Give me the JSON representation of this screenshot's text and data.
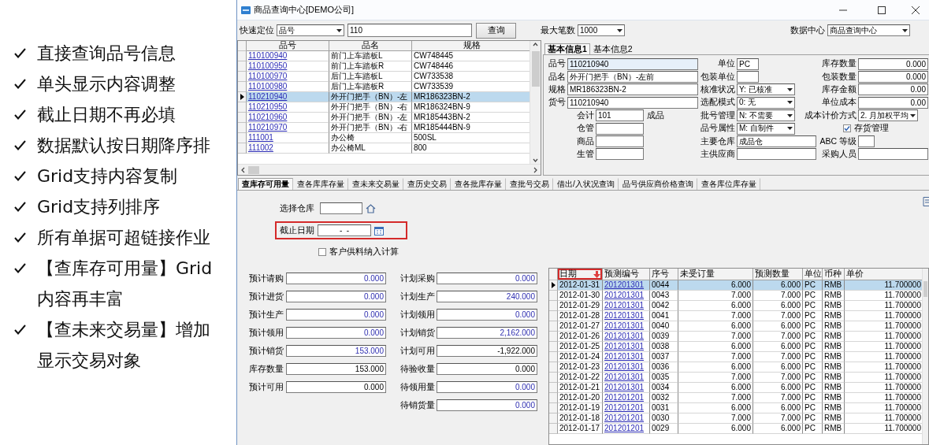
{
  "features": [
    {
      "text": "直接查询品号信息"
    },
    {
      "text": "单头显示内容调整"
    },
    {
      "text": "截止日期不再必填"
    },
    {
      "text": "数据默认按日期降序排"
    },
    {
      "text": "Grid支持内容复制"
    },
    {
      "text": "Grid支持列排序"
    },
    {
      "text": "所有单据可超链接作业"
    },
    {
      "text": "【查库存可用量】Grid内容再丰富"
    },
    {
      "text": "【查未来交易量】增加显示交易对象"
    }
  ],
  "window": {
    "title": "商品查询中心[DEMO公司]"
  },
  "toolbar": {
    "locate_label": "快速定位",
    "locate_field": "品号",
    "locate_value": "110",
    "query_button": "查询",
    "max_rows_label": "最大笔数",
    "max_rows": "1000",
    "data_center_label": "数据中心",
    "data_center": "商品查询中心"
  },
  "product_grid": {
    "columns": [
      "品号",
      "品名",
      "规格"
    ],
    "rows": [
      {
        "cells": [
          "110100940",
          "前门上车踏板L",
          "CW748445"
        ],
        "selected": false
      },
      {
        "cells": [
          "110100950",
          "前门上车踏板R",
          "CW748446"
        ],
        "selected": false
      },
      {
        "cells": [
          "110100970",
          "后门上车踏板L",
          "CW733538"
        ],
        "selected": false
      },
      {
        "cells": [
          "110100980",
          "后门上车踏板R",
          "CW733539"
        ],
        "selected": false
      },
      {
        "cells": [
          "110210940",
          "外开门把手（BN）-左",
          "MR186323BN-2"
        ],
        "selected": true
      },
      {
        "cells": [
          "110210950",
          "外开门把手（BN）-右",
          "MR186324BN-9"
        ],
        "selected": false
      },
      {
        "cells": [
          "110210960",
          "外开门把手（BN）-左",
          "MR185443BN-2"
        ],
        "selected": false
      },
      {
        "cells": [
          "110210970",
          "外开门把手（BN）-右",
          "MR185444BN-9"
        ],
        "selected": false
      },
      {
        "cells": [
          "111001",
          "办公椅",
          "500SL"
        ],
        "selected": false
      },
      {
        "cells": [
          "111002",
          "办公椅ML",
          "800"
        ],
        "selected": false
      }
    ]
  },
  "info_tabs": [
    {
      "label": "基本信息1",
      "selected": true
    },
    {
      "label": "基本信息2",
      "selected": false
    }
  ],
  "info": {
    "identity_fields": [
      {
        "label": "品号",
        "value": "110210940",
        "focused": true
      },
      {
        "label": "品名",
        "value": "外开门把手（BN）-左前",
        "focused": false
      },
      {
        "label": "规格",
        "value": "MR186323BN-2",
        "focused": false
      },
      {
        "label": "货号",
        "value": "110210940",
        "focused": false
      }
    ],
    "manager_fields": [
      {
        "label": "会计",
        "value": "101",
        "suffix": "成品"
      },
      {
        "label": "仓管"
      },
      {
        "label": "商品"
      },
      {
        "label": "生管"
      }
    ],
    "middle_fields": [
      {
        "kind": "text",
        "label": "单位",
        "value": "PC"
      },
      {
        "kind": "text",
        "label": "包装单位"
      },
      {
        "kind": "select",
        "label": "核准状况",
        "value": "Y: 已核准"
      },
      {
        "kind": "select",
        "label": "选配模式",
        "value": "0: 无"
      },
      {
        "kind": "select",
        "label": "批号管理",
        "value": "N: 不需要"
      },
      {
        "kind": "select",
        "label": "品号属性",
        "value": "M: 自制件"
      },
      {
        "kind": "text",
        "label": "主要仓库",
        "value": "成品仓"
      },
      {
        "kind": "text",
        "label": "主供应商"
      }
    ],
    "right_fields": [
      {
        "kind": "number",
        "label": "库存数量",
        "value": "0.000"
      },
      {
        "kind": "number",
        "label": "包装数量",
        "value": "0.000"
      },
      {
        "kind": "number",
        "label": "库存金额",
        "value": "0.00"
      },
      {
        "kind": "number",
        "label": "单位成本",
        "value": "0.00"
      },
      {
        "kind": "select",
        "label": "成本计价方式",
        "value": "2. 月加权平均"
      },
      {
        "kind": "checkbox",
        "label": "存货管理",
        "checked": true
      },
      {
        "kind": "text",
        "label": "ABC 等级"
      },
      {
        "kind": "text",
        "label": "采购人员"
      }
    ]
  },
  "query_tabs": [
    {
      "label": "查库存可用量",
      "selected": true
    },
    {
      "label": "查各库库存量",
      "selected": false
    },
    {
      "label": "查未来交易量",
      "selected": false
    },
    {
      "label": "查历史交易",
      "selected": false
    },
    {
      "label": "查各批库存量",
      "selected": false
    },
    {
      "label": "查批号交易",
      "selected": false
    },
    {
      "label": "借出/入状况查询",
      "selected": false
    },
    {
      "label": "品号供应商价格查询",
      "selected": false
    },
    {
      "label": "查各库位库存量",
      "selected": false
    }
  ],
  "filters": {
    "warehouse_label": "选择仓库",
    "cutoff_label": "截止日期",
    "cutoff_value": "-  -",
    "cutoff_highlighted": true,
    "customer_material": {
      "label": "客户供料纳入计算",
      "checked": false
    }
  },
  "quantities": {
    "left": [
      {
        "label": "预计请购",
        "value": "0.000",
        "linked": true
      },
      {
        "label": "预计进货",
        "value": "0.000",
        "linked": true
      },
      {
        "label": "预计生产",
        "value": "0.000",
        "linked": true
      },
      {
        "label": "预计领用",
        "value": "0.000",
        "linked": true
      },
      {
        "label": "预计销货",
        "value": "153.000",
        "linked": true
      },
      {
        "label": "库存数量",
        "value": "153.000",
        "linked": false
      },
      {
        "label": "预计可用",
        "value": "0.000",
        "linked": false
      }
    ],
    "right": [
      {
        "label": "计划采购",
        "value": "0.000",
        "linked": true
      },
      {
        "label": "计划生产",
        "value": "240.000",
        "linked": true
      },
      {
        "label": "计划领用",
        "value": "0.000",
        "linked": true
      },
      {
        "label": "计划销货",
        "value": "2,162.000",
        "linked": true
      },
      {
        "label": "计划可用",
        "value": "-1,922.000",
        "linked": false
      },
      {
        "label": "待验收量",
        "value": "0.000",
        "linked": false
      },
      {
        "label": "待领用量",
        "value": "0.000",
        "linked": true
      },
      {
        "label": "待销货量",
        "value": "0.000",
        "linked": true
      }
    ]
  },
  "forecast_grid": {
    "columns": [
      {
        "label": "日期",
        "kind": "text",
        "sorted_descending": true,
        "highlighted": true
      },
      {
        "label": "预测编号",
        "kind": "link",
        "sorted_descending": false,
        "highlighted": false
      },
      {
        "label": "序号",
        "kind": "text",
        "sorted_descending": false,
        "highlighted": false
      },
      {
        "label": "未受订量",
        "kind": "number",
        "sorted_descending": false,
        "highlighted": false
      },
      {
        "label": "预测数量",
        "kind": "number",
        "sorted_descending": false,
        "highlighted": false
      },
      {
        "label": "单位",
        "kind": "text",
        "sorted_descending": false,
        "highlighted": false
      },
      {
        "label": "币种",
        "kind": "text",
        "sorted_descending": false,
        "highlighted": false
      },
      {
        "label": "单价",
        "kind": "number",
        "sorted_descending": false,
        "highlighted": false
      }
    ],
    "rows": [
      {
        "cells": [
          "2012-01-31",
          "201201301",
          "0044",
          "6.000",
          "6.000",
          "PC",
          "RMB",
          "11.700000"
        ],
        "selected": true
      },
      {
        "cells": [
          "2012-01-30",
          "201201301",
          "0043",
          "7.000",
          "7.000",
          "PC",
          "RMB",
          "11.700000"
        ],
        "selected": false
      },
      {
        "cells": [
          "2012-01-29",
          "201201301",
          "0042",
          "6.000",
          "6.000",
          "PC",
          "RMB",
          "11.700000"
        ],
        "selected": false
      },
      {
        "cells": [
          "2012-01-28",
          "201201301",
          "0041",
          "7.000",
          "7.000",
          "PC",
          "RMB",
          "11.700000"
        ],
        "selected": false
      },
      {
        "cells": [
          "2012-01-27",
          "201201301",
          "0040",
          "6.000",
          "6.000",
          "PC",
          "RMB",
          "11.700000"
        ],
        "selected": false
      },
      {
        "cells": [
          "2012-01-26",
          "201201301",
          "0039",
          "7.000",
          "7.000",
          "PC",
          "RMB",
          "11.700000"
        ],
        "selected": false
      },
      {
        "cells": [
          "2012-01-25",
          "201201301",
          "0038",
          "6.000",
          "6.000",
          "PC",
          "RMB",
          "11.700000"
        ],
        "selected": false
      },
      {
        "cells": [
          "2012-01-24",
          "201201301",
          "0037",
          "7.000",
          "7.000",
          "PC",
          "RMB",
          "11.700000"
        ],
        "selected": false
      },
      {
        "cells": [
          "2012-01-23",
          "201201301",
          "0036",
          "6.000",
          "6.000",
          "PC",
          "RMB",
          "11.700000"
        ],
        "selected": false
      },
      {
        "cells": [
          "2012-01-22",
          "201201301",
          "0035",
          "7.000",
          "7.000",
          "PC",
          "RMB",
          "11.700000"
        ],
        "selected": false
      },
      {
        "cells": [
          "2012-01-21",
          "201201301",
          "0034",
          "6.000",
          "6.000",
          "PC",
          "RMB",
          "11.700000"
        ],
        "selected": false
      },
      {
        "cells": [
          "2012-01-20",
          "201201201",
          "0032",
          "7.000",
          "7.000",
          "PC",
          "RMB",
          "11.700000"
        ],
        "selected": false
      },
      {
        "cells": [
          "2012-01-19",
          "201201201",
          "0031",
          "6.000",
          "6.000",
          "PC",
          "RMB",
          "11.700000"
        ],
        "selected": false
      },
      {
        "cells": [
          "2012-01-18",
          "201201201",
          "0030",
          "7.000",
          "7.000",
          "PC",
          "RMB",
          "11.700000"
        ],
        "selected": false
      },
      {
        "cells": [
          "2012-01-17",
          "201201201",
          "0029",
          "6.000",
          "6.000",
          "PC",
          "RMB",
          "11.700000"
        ],
        "selected": false
      }
    ]
  }
}
